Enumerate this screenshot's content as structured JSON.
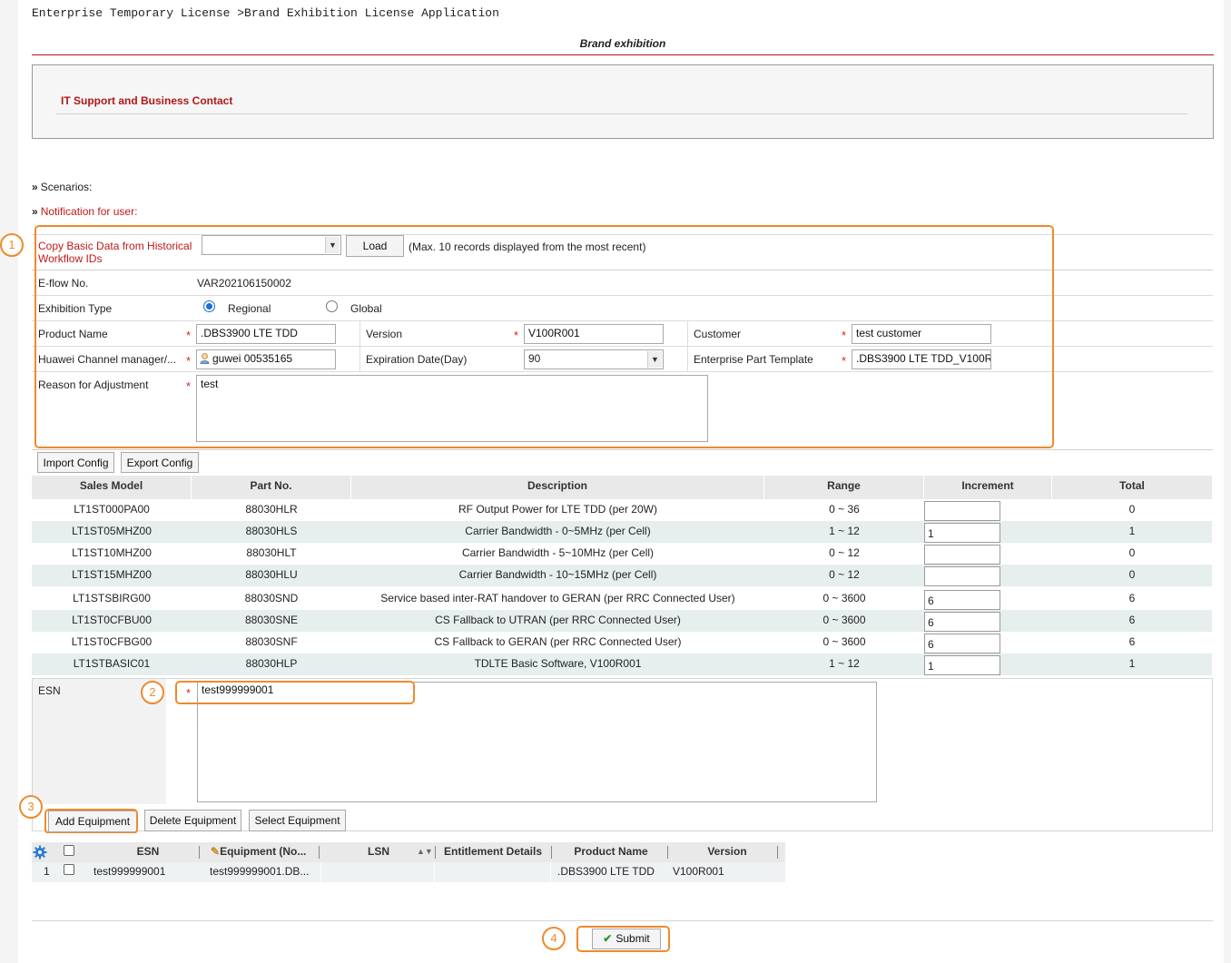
{
  "breadcrumb": "Enterprise Temporary License >Brand Exhibition License Application",
  "page_title": "Brand exhibition",
  "contact_section": {
    "title": "IT Support and Business Contact"
  },
  "notices": {
    "scenarios_label": "Scenarios:",
    "notification_label": "Notification for user:"
  },
  "form": {
    "copy_label_line1": "Copy Basic Data from Historical",
    "copy_label_line2": "Workflow IDs",
    "copy_select_value": "",
    "load_button": "Load",
    "load_hint": "(Max. 10 records displayed from the most recent)",
    "eflow_label": "E-flow No.",
    "eflow_value": "VAR202106150002",
    "exhibition_type_label": "Exhibition Type",
    "exhibition_options": [
      "Regional",
      "Global"
    ],
    "exhibition_selected": "Regional",
    "product_name_label": "Product Name",
    "product_name_value": ".DBS3900 LTE TDD",
    "version_label": "Version",
    "version_value": "V100R001",
    "customer_label": "Customer",
    "customer_value": "test customer",
    "channel_manager_label": "Huawei Channel manager/...",
    "channel_manager_value": "guwei 00535165",
    "expiration_label": "Expiration Date(Day)",
    "expiration_value": "90",
    "part_template_label": "Enterprise Part Template",
    "part_template_value": ".DBS3900 LTE TDD_V100R",
    "reason_label": "Reason for Adjustment",
    "reason_value": "test",
    "required_mark": "*"
  },
  "config_buttons": {
    "import": "Import Config",
    "export": "Export Config"
  },
  "config_table": {
    "headers": [
      "Sales Model",
      "Part No.",
      "Description",
      "Range",
      "Increment",
      "Total"
    ],
    "rows": [
      {
        "model": "LT1ST000PA00",
        "part": "88030HLR",
        "desc": "RF Output Power for LTE TDD (per 20W)",
        "range": "0 ~ 36",
        "inc": "",
        "total": "0"
      },
      {
        "model": "LT1ST05MHZ00",
        "part": "88030HLS",
        "desc": "Carrier Bandwidth - 0~5MHz (per Cell)",
        "range": "1 ~ 12",
        "inc": "1",
        "total": "1"
      },
      {
        "model": "LT1ST10MHZ00",
        "part": "88030HLT",
        "desc": "Carrier Bandwidth - 5~10MHz (per Cell)",
        "range": "0 ~ 12",
        "inc": "",
        "total": "0"
      },
      {
        "model": "LT1ST15MHZ00",
        "part": "88030HLU",
        "desc": "Carrier Bandwidth - 10~15MHz (per Cell)",
        "range": "0 ~ 12",
        "inc": "",
        "total": "0"
      },
      {
        "model": "LT1STSBIRG00",
        "part": "88030SND",
        "desc": "Service based inter-RAT handover to GERAN (per RRC Connected User)",
        "range": "0 ~ 3600",
        "inc": "6",
        "total": "6"
      },
      {
        "model": "LT1ST0CFBU00",
        "part": "88030SNE",
        "desc": "CS Fallback to UTRAN (per RRC Connected User)",
        "range": "0 ~ 3600",
        "inc": "6",
        "total": "6"
      },
      {
        "model": "LT1ST0CFBG00",
        "part": "88030SNF",
        "desc": "CS Fallback to GERAN (per RRC Connected User)",
        "range": "0 ~ 3600",
        "inc": "6",
        "total": "6"
      },
      {
        "model": "LT1STBASIC01",
        "part": "88030HLP",
        "desc": "TDLTE Basic Software, V100R001",
        "range": "1 ~ 12",
        "inc": "1",
        "total": "1"
      }
    ]
  },
  "esn": {
    "label": "ESN",
    "value": "test999999001"
  },
  "equipment_buttons": {
    "add": "Add Equipment",
    "delete": "Delete Equipment",
    "select": "Select Equipment"
  },
  "equipment_grid": {
    "headers": [
      "ESN",
      "Equipment (No...",
      "LSN",
      "Entitlement Details",
      "Product Name",
      "Version"
    ],
    "rows": [
      {
        "index": "1",
        "esn": "test999999001",
        "equipment": "test999999001.DB...",
        "lsn": "",
        "entitlement": "",
        "product": ".DBS3900 LTE TDD",
        "version": "V100R001"
      }
    ]
  },
  "submit_button": "Submit",
  "badges": [
    "1",
    "2",
    "3",
    "4"
  ],
  "colors": {
    "accent_red": "#c01818",
    "highlight_orange": "#ef8a2c",
    "radio_blue": "#1a6fd8"
  }
}
